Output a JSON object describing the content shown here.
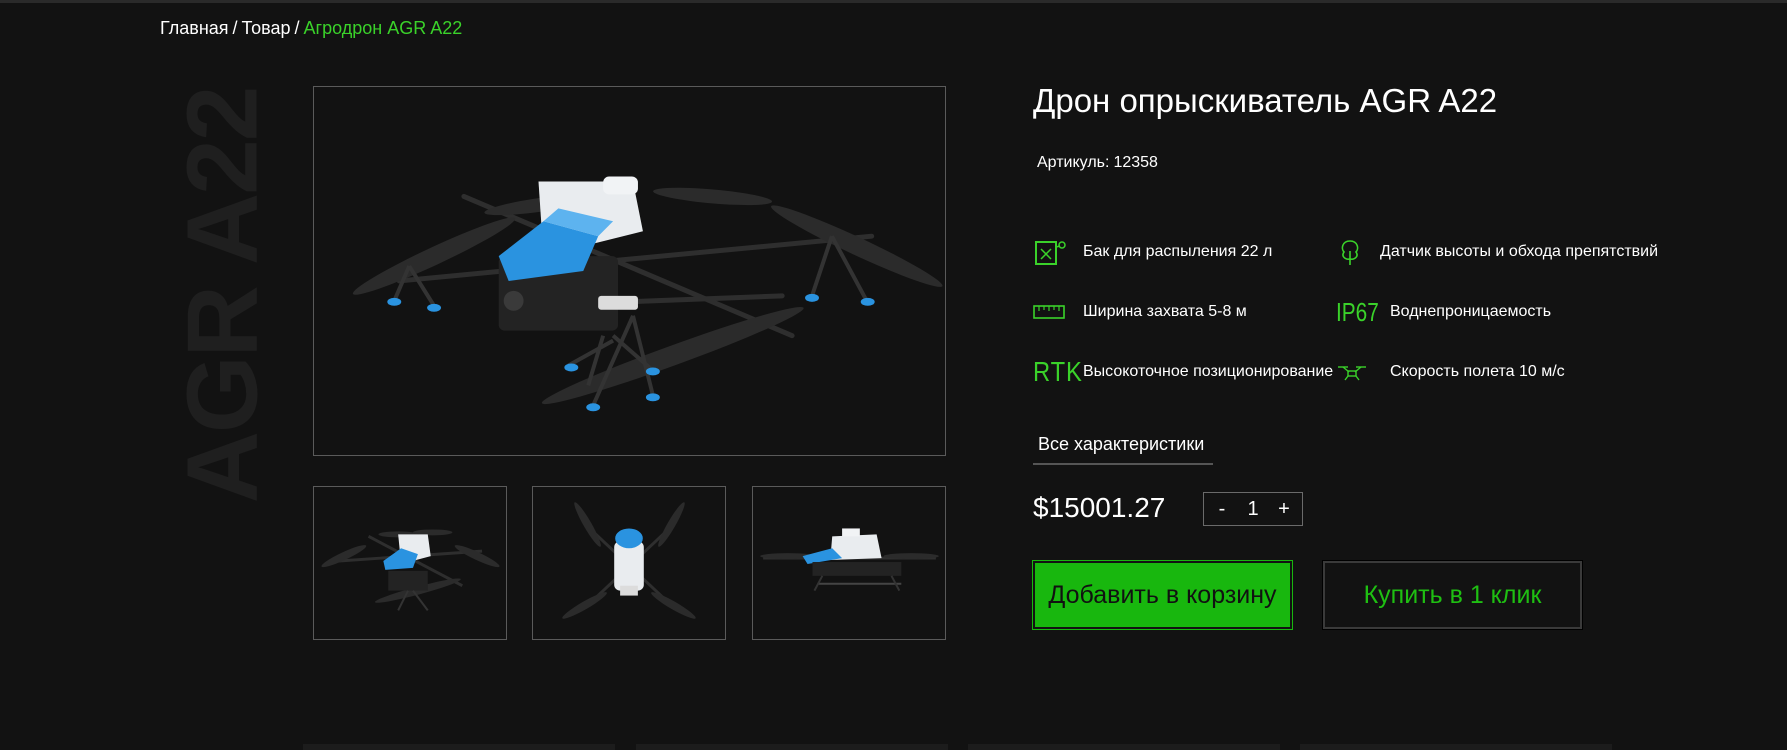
{
  "breadcrumb": {
    "home": "Главная",
    "separator": "/",
    "section": "Товар",
    "current": "Агродрон AGR A22"
  },
  "gallery": {
    "vertical_label": "AGR A22"
  },
  "product": {
    "title": "Дрон опрыскиватель AGR A22",
    "article_label": "Артикуль:",
    "article_value": "12358",
    "features": [
      {
        "icon": "spray-tank-icon",
        "text": "Бак для распыления 22 л"
      },
      {
        "icon": "tree-sensor-icon",
        "text": "Датчик высоты и обхода препятствий"
      },
      {
        "icon": "ruler-icon",
        "text": "Ширина захвата 5-8 м"
      },
      {
        "icon_text": "IP67",
        "text": "Воднепроницаемость"
      },
      {
        "icon_text": "RTK",
        "text": "Высокоточное позиционирование"
      },
      {
        "icon": "drone-icon",
        "text": "Скорость полета 10 м/с"
      }
    ],
    "all_specs_label": "Все характеристики",
    "price": "$15001.27",
    "quantity": {
      "minus": "-",
      "value": "1",
      "plus": "+"
    },
    "add_to_cart_label": "Добавить в корзину",
    "buy_one_click_label": "Купить в 1 клик"
  },
  "colors": {
    "accent": "#3ad22a",
    "button_green": "#18b70e",
    "background": "#121212",
    "drone_blue": "#2a93e0"
  }
}
